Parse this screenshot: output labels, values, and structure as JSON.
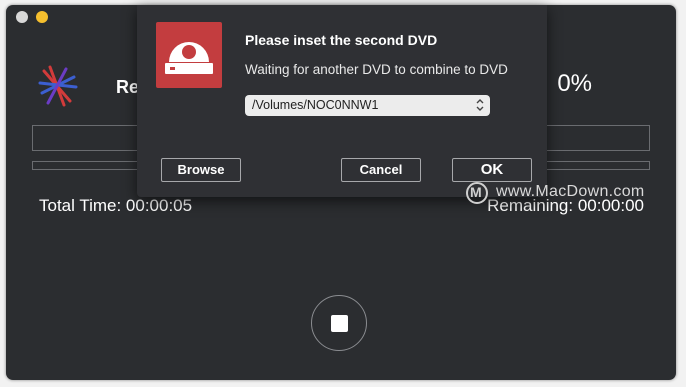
{
  "window": {
    "controls": [
      "close",
      "minimize"
    ]
  },
  "status": {
    "label_fragment": "Re",
    "percent": "0%"
  },
  "progress": {
    "fraction": 0
  },
  "times": {
    "total": "Total Time: 00:00:05",
    "remaining": "Remaining: 00:00:00"
  },
  "dialog": {
    "icon": "dvd-drive-icon",
    "title": "Please inset the second DVD",
    "message": "Waiting for another DVD to combine to DVD",
    "volume_select": "/Volumes/NOC0NNW1",
    "buttons": {
      "browse": "Browse",
      "cancel": "Cancel",
      "ok": "OK"
    },
    "accent": "#c33d3f"
  },
  "watermark": {
    "text": "www.MacDown.com",
    "logo_letter": "M"
  }
}
